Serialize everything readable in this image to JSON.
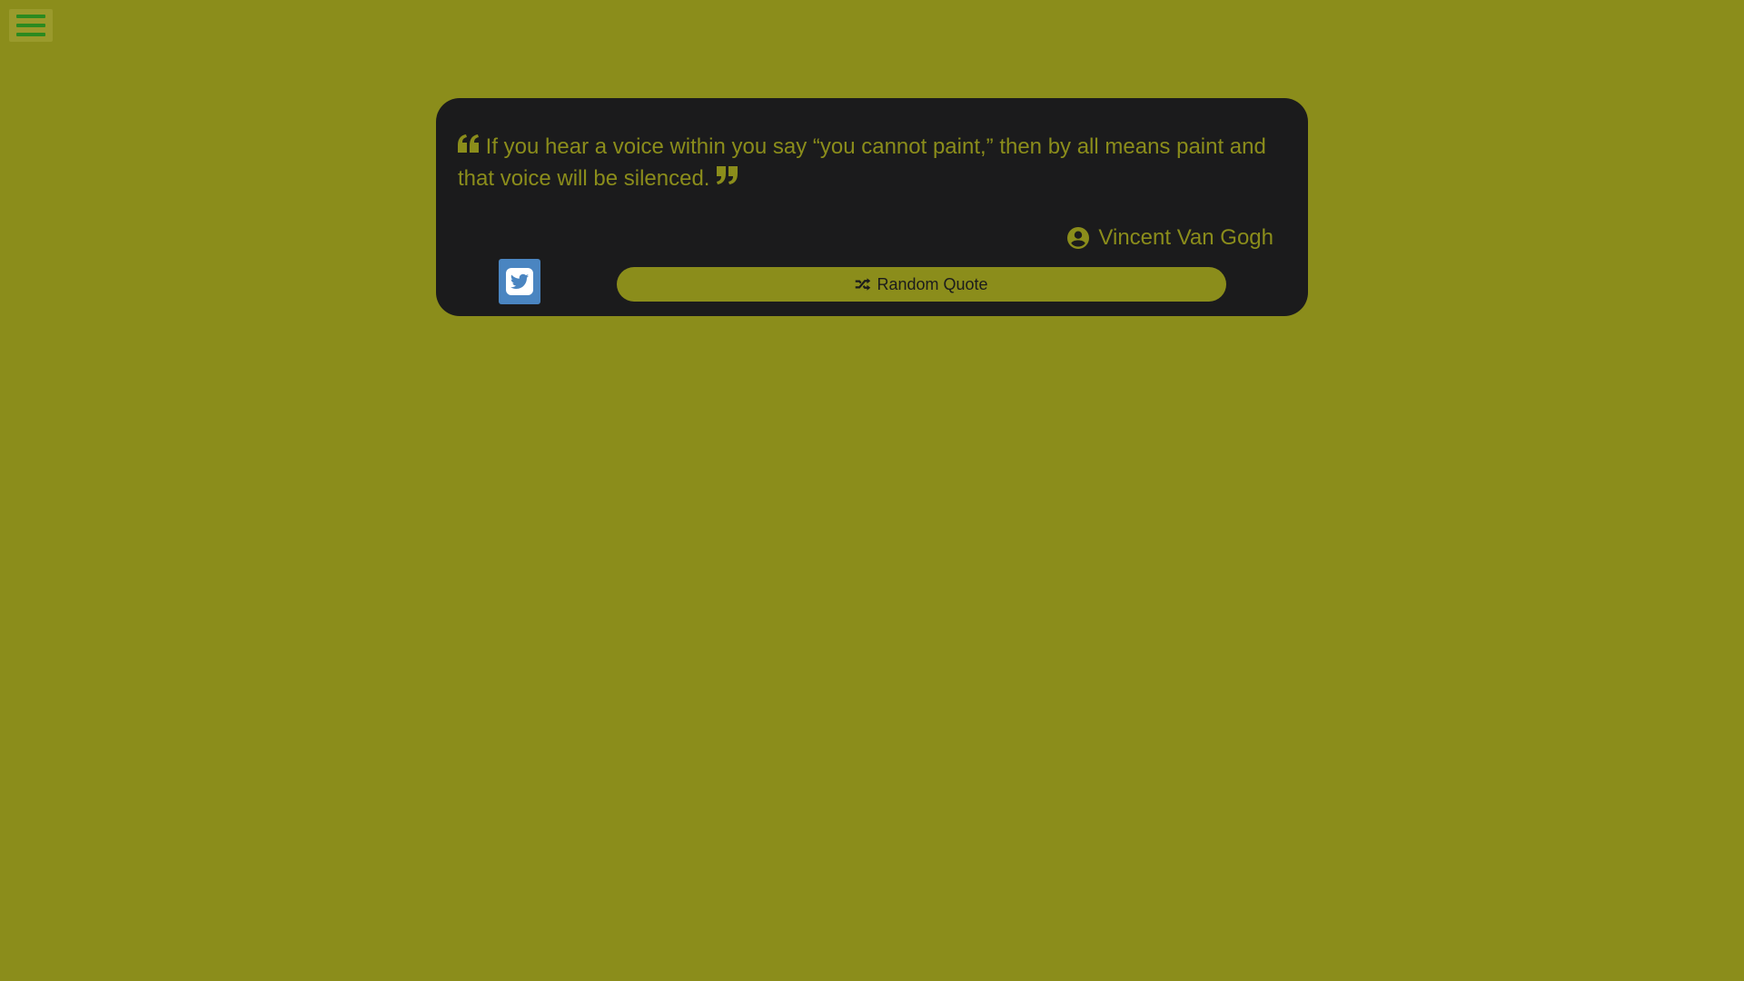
{
  "menu": {
    "icon": "hamburger-menu-icon"
  },
  "quote": {
    "text": "If you hear a voice within you say “you cannot paint,” then by all means paint and that voice will be silenced.",
    "open_icon": "quote-left-icon",
    "close_icon": "quote-right-icon"
  },
  "author": {
    "name": "Vincent Van Gogh",
    "icon": "user-circle-icon"
  },
  "actions": {
    "tweet_icon": "twitter-square-icon",
    "random_label": "Random Quote",
    "random_icon": "shuffle-icon"
  },
  "colors": {
    "background": "#8b8d1b",
    "card": "#1b1b1c",
    "accent": "#8b8d1b",
    "menu_bars": "#2b8a1f",
    "twitter": "#4a85c1"
  }
}
